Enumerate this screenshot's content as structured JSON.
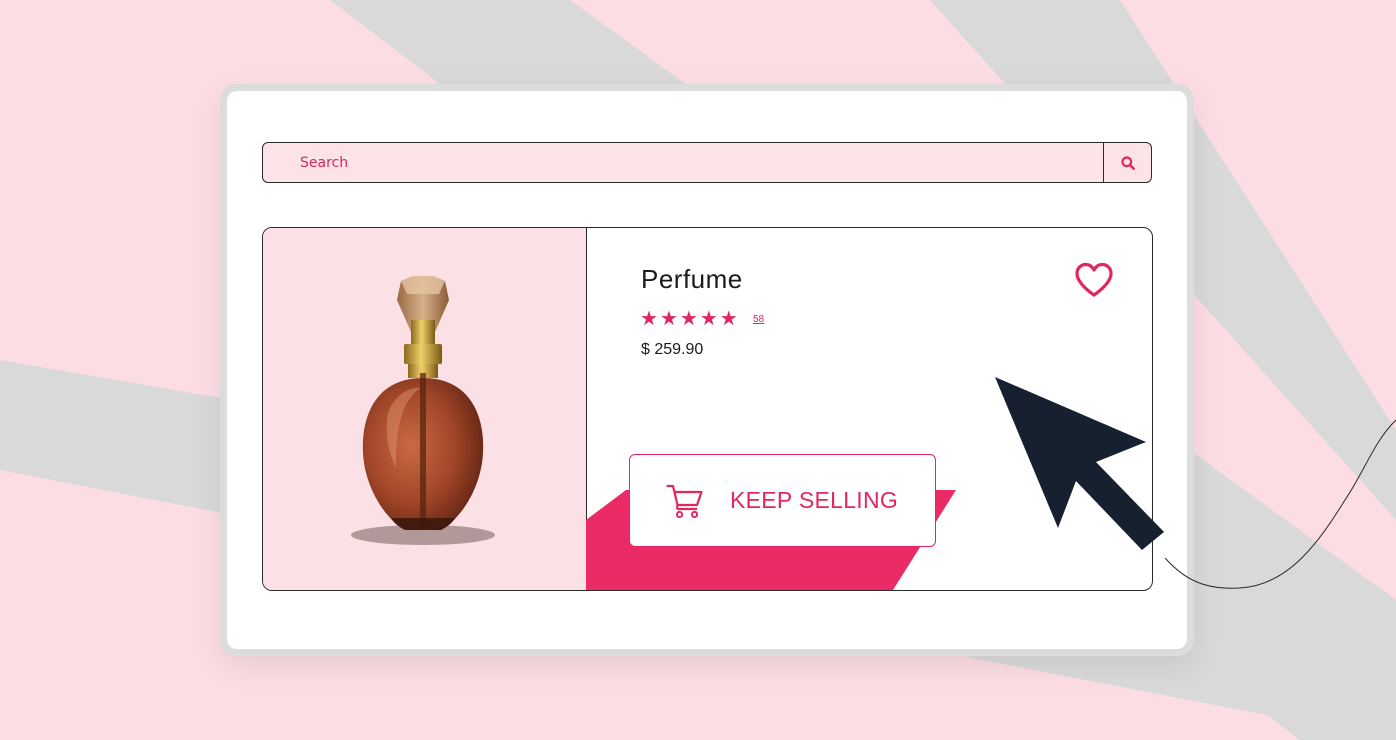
{
  "search": {
    "placeholder": "Search",
    "search_icon": "magnifier-icon"
  },
  "product": {
    "title": "Perfume",
    "rating": 5,
    "rating_max": 5,
    "star_glyph": "★",
    "review_count": "58",
    "price": "$ 259.90",
    "favorite_icon": "heart-icon",
    "image": "perfume-bottle"
  },
  "cta": {
    "label": "KEEP SELLING",
    "icon": "cart-icon"
  },
  "colors": {
    "accent": "#e2265f",
    "pink_bg": "#fbdde3",
    "cursor": "#16202f"
  }
}
